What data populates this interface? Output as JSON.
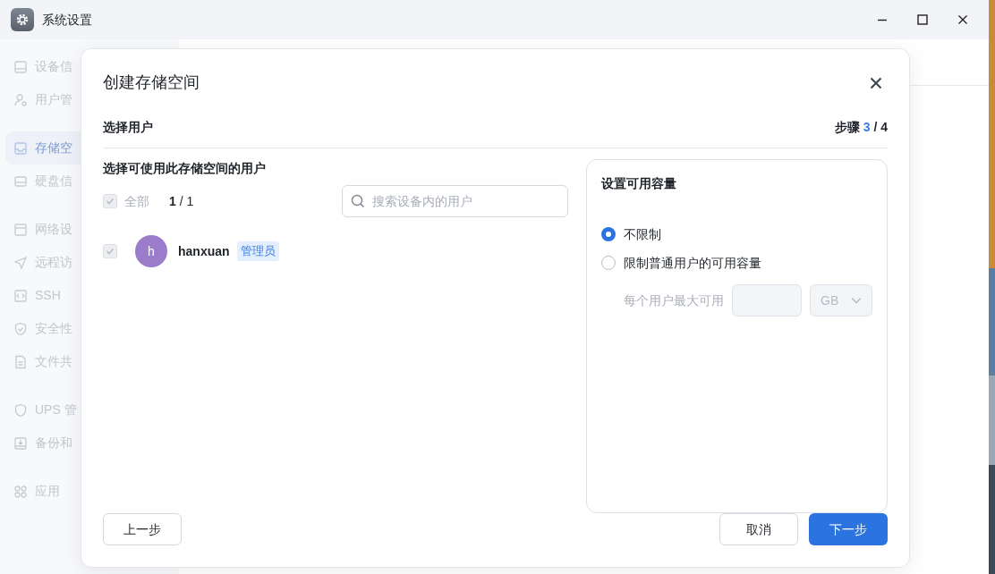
{
  "window": {
    "title": "系统设置"
  },
  "sidebar": {
    "groups": [
      {
        "items": [
          {
            "label": "设备信",
            "selected": false
          },
          {
            "label": "用户管",
            "selected": false
          }
        ]
      },
      {
        "items": [
          {
            "label": "存储空",
            "selected": true
          },
          {
            "label": "硬盘信",
            "selected": false
          }
        ]
      },
      {
        "items": [
          {
            "label": "网络设",
            "selected": false
          },
          {
            "label": "远程访",
            "selected": false
          },
          {
            "label": "SSH",
            "selected": false
          },
          {
            "label": "安全性",
            "selected": false
          },
          {
            "label": "文件共",
            "selected": false
          }
        ]
      },
      {
        "items": [
          {
            "label": "UPS 管",
            "selected": false
          },
          {
            "label": "备份和",
            "selected": false
          }
        ]
      },
      {
        "items": [
          {
            "label": "应用",
            "selected": false
          }
        ]
      }
    ]
  },
  "dialog": {
    "title": "创建存储空间",
    "step_label": "选择用户",
    "step_prefix": "步骤",
    "step_current": "3",
    "step_total": "/ 4",
    "users_section": {
      "heading": "选择可使用此存储空间的用户",
      "select_all": {
        "label": "全部",
        "checked": true,
        "disabled": true
      },
      "count": "**1** / 1",
      "search": {
        "placeholder": "搜索设备内的用户"
      },
      "users": [
        {
          "avatar": "h",
          "name": "hanxuan",
          "role": "管理员",
          "checked": true,
          "disabled": true
        }
      ]
    },
    "capacity": {
      "title": "设置可用容量",
      "options": [
        {
          "label": "不限制",
          "selected": true
        },
        {
          "label": "限制普通用户的可用容量",
          "selected": false
        }
      ],
      "limit": {
        "label": "每个用户最大可用",
        "unit": "GB",
        "disabled": true
      }
    },
    "buttons": {
      "back": "上一步",
      "cancel": "取消",
      "next": "下一步"
    }
  }
}
